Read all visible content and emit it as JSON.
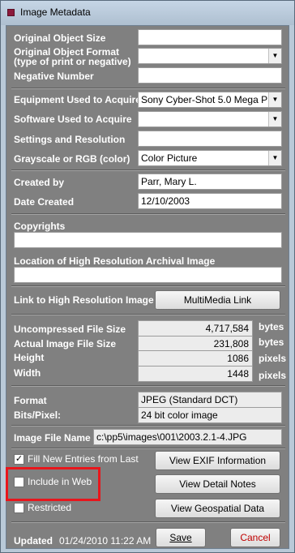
{
  "window": {
    "title": "Image Metadata"
  },
  "fields": {
    "original_object_size": {
      "label": "Original Object Size",
      "value": ""
    },
    "original_object_format": {
      "label_line1": "Original Object Format",
      "label_line2": "(type of print or negative)",
      "value": ""
    },
    "negative_number": {
      "label": "Negative Number",
      "value": ""
    },
    "equipment": {
      "label": "Equipment Used to Acquire",
      "value": "Sony Cyber-Shot 5.0 Mega P"
    },
    "software": {
      "label": "Software Used to Acquire",
      "value": ""
    },
    "settings": {
      "label": "Settings and Resolution",
      "value": ""
    },
    "grayscale": {
      "label": "Grayscale or RGB (color)",
      "value": "Color Picture"
    },
    "created_by": {
      "label": "Created by",
      "value": "Parr, Mary L."
    },
    "date_created": {
      "label": "Date Created",
      "value": "12/10/2003"
    },
    "copyrights": {
      "label": "Copyrights",
      "value": ""
    },
    "location": {
      "label": "Location of High Resolution Archival Image",
      "value": ""
    },
    "link": {
      "label": "Link to High Resolution Image",
      "button": "MultiMedia Link"
    }
  },
  "file_info": {
    "uncompressed": {
      "label": "Uncompressed File Size",
      "value": "4,717,584",
      "unit": "bytes"
    },
    "actual": {
      "label": "Actual Image File Size",
      "value": "231,808",
      "unit": "bytes"
    },
    "height": {
      "label": "Height",
      "value": "1086",
      "unit": "pixels"
    },
    "width": {
      "label": "Width",
      "value": "1448",
      "unit": "pixels"
    }
  },
  "format_info": {
    "format": {
      "label": "Format",
      "value": "JPEG (Standard DCT)"
    },
    "bits": {
      "label": "Bits/Pixel:",
      "value": "24 bit color image"
    }
  },
  "image_file": {
    "label": "Image File Name",
    "value": "c:\\pp5\\images\\001\\2003.2.1-4.JPG"
  },
  "checkboxes": {
    "fill_new": {
      "label": "Fill New Entries from Last",
      "checked": true,
      "mark": "✓"
    },
    "include_web": {
      "label": "Include in Web",
      "checked": false
    },
    "restricted": {
      "label": "Restricted",
      "checked": false
    }
  },
  "buttons": {
    "exif": "View EXIF Information",
    "detail_notes": "View Detail Notes",
    "geospatial": "View Geospatial Data",
    "save": "Save",
    "cancel": "Cancel"
  },
  "footer": {
    "updated_label": "Updated",
    "updated_value": "01/24/2010 11:22 AM"
  },
  "icons": {
    "dropdown": "chevron-down-icon",
    "window": "app-icon"
  },
  "colors": {
    "highlight": "#e8161c",
    "cancel_text": "#c00000",
    "panel": "#808080"
  }
}
